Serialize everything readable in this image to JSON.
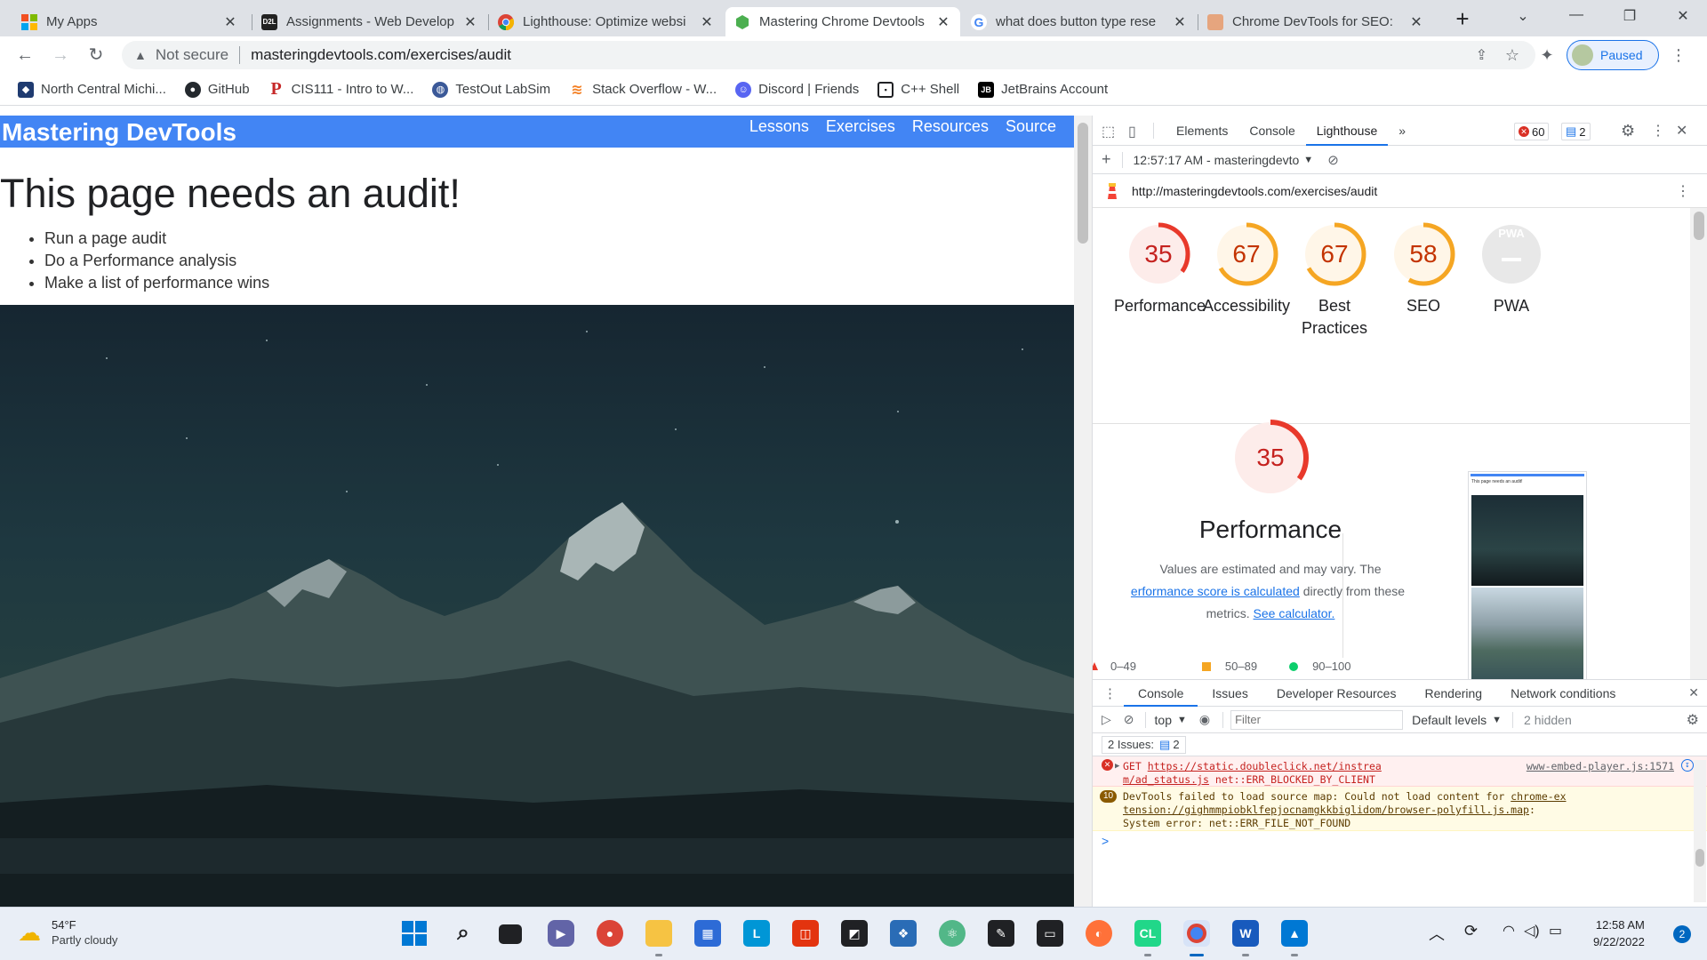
{
  "browser": {
    "tabs": [
      {
        "title": "My Apps",
        "favicon": "windows-logo-icon",
        "active": false
      },
      {
        "title": "Assignments - Web Develop",
        "favicon": "d2l-icon",
        "active": false
      },
      {
        "title": "Lighthouse: Optimize websi",
        "favicon": "chrome-icon",
        "active": false
      },
      {
        "title": "Mastering Chrome Devtools",
        "favicon": "hexagon-icon",
        "active": true
      },
      {
        "title": "what does button type rese",
        "favicon": "google-icon",
        "active": false
      },
      {
        "title": "Chrome DevTools for SEO: ",
        "favicon": "person-icon",
        "active": false
      }
    ],
    "new_tab": "+",
    "address": {
      "security": "Not secure",
      "url": "masteringdevtools.com/exercises/audit"
    },
    "profile_status": "Paused",
    "bookmarks": [
      {
        "label": "North Central Michi...",
        "icon": "shield-crest-icon"
      },
      {
        "label": "GitHub",
        "icon": "github-icon"
      },
      {
        "label": "CIS111 - Intro to W...",
        "icon": "letter-p-icon"
      },
      {
        "label": "TestOut LabSim",
        "icon": "globe-icon"
      },
      {
        "label": "Stack Overflow - W...",
        "icon": "stackoverflow-icon"
      },
      {
        "label": "Discord | Friends",
        "icon": "discord-icon"
      },
      {
        "label": "C++ Shell",
        "icon": "terminal-icon"
      },
      {
        "label": "JetBrains Account",
        "icon": "jetbrains-icon"
      }
    ]
  },
  "page": {
    "brand": "Mastering DevTools",
    "nav": [
      "Lessons",
      "Exercises",
      "Resources",
      "Source"
    ],
    "heading": "This page needs an audit!",
    "tasks": [
      "Run a page audit",
      "Do a Performance analysis",
      "Make a list of performance wins"
    ],
    "hero_image": "night-mountain-landscape"
  },
  "devtools": {
    "tabs": [
      "Elements",
      "Console",
      "Lighthouse"
    ],
    "active_tab": "Lighthouse",
    "more_tabs": "»",
    "error_count": "60",
    "issue_count": "2",
    "report_selector": "12:57:17 AM - masteringdevto",
    "report_url": "http://masteringdevtools.com/exercises/audit",
    "scores": [
      {
        "label": "Performance",
        "score": 35,
        "value": "35",
        "color": "#e8392b",
        "bg": "#fdecea"
      },
      {
        "label": "Accessibility",
        "score": 67,
        "value": "67",
        "color": "#f5a623",
        "bg": "#fff6e8"
      },
      {
        "label": "Best\nPractices",
        "score": 67,
        "value": "67",
        "color": "#f5a623",
        "bg": "#fff6e8"
      },
      {
        "label": "SEO",
        "score": 58,
        "value": "58",
        "color": "#f5a623",
        "bg": "#fff6e8"
      },
      {
        "label": "PWA",
        "score": null,
        "value": "PWA",
        "color": "#9aa0a6",
        "bg": "#e8e8e8"
      }
    ],
    "performance": {
      "score": "35",
      "score_fraction": 0.35,
      "title": "Performance",
      "desc_1": "Values are estimated and may vary. The",
      "desc_link_1": "erformance score is calculated",
      "desc_2": "directly from these",
      "desc_3": "metrics.",
      "desc_link_2": "See calculator."
    },
    "legend": [
      {
        "range": "0–49",
        "color": "#e8392b"
      },
      {
        "range": "50–89",
        "color": "#f5a623"
      },
      {
        "range": "90–100",
        "color": "#0cce6b"
      }
    ],
    "screenshot_heading": "This page needs an audit!",
    "drawer": {
      "tabs": [
        "Console",
        "Issues",
        "Developer Resources",
        "Rendering",
        "Network conditions"
      ],
      "context": "top",
      "filter_placeholder": "Filter",
      "levels": "Default levels",
      "hidden": "2 hidden",
      "issues_label": "2 Issues:",
      "issues_count": "2",
      "messages": [
        {
          "type": "error",
          "method": "GET",
          "link_line1": "https://static.doubleclick.net/instrea",
          "link_line2": "m/ad_status.js",
          "text": "net::ERR_BLOCKED_BY_CLIENT",
          "source": "www-embed-player.js:1571"
        },
        {
          "type": "warning",
          "count": "10",
          "text1": "DevTools failed to load source map: Could not load content for",
          "link1": "chrome-ex",
          "link2": "tension://gighmmpiobklfepjocnamgkkbiglidom/browser-polyfill.js.map",
          "text2": ":",
          "text3": "System error: net::ERR_FILE_NOT_FOUND"
        }
      ],
      "prompt": ">"
    }
  },
  "taskbar": {
    "weather_temp": "54°F",
    "weather_desc": "Partly cloudy",
    "time": "12:58 AM",
    "date": "9/22/2022",
    "notification_count": "2"
  }
}
